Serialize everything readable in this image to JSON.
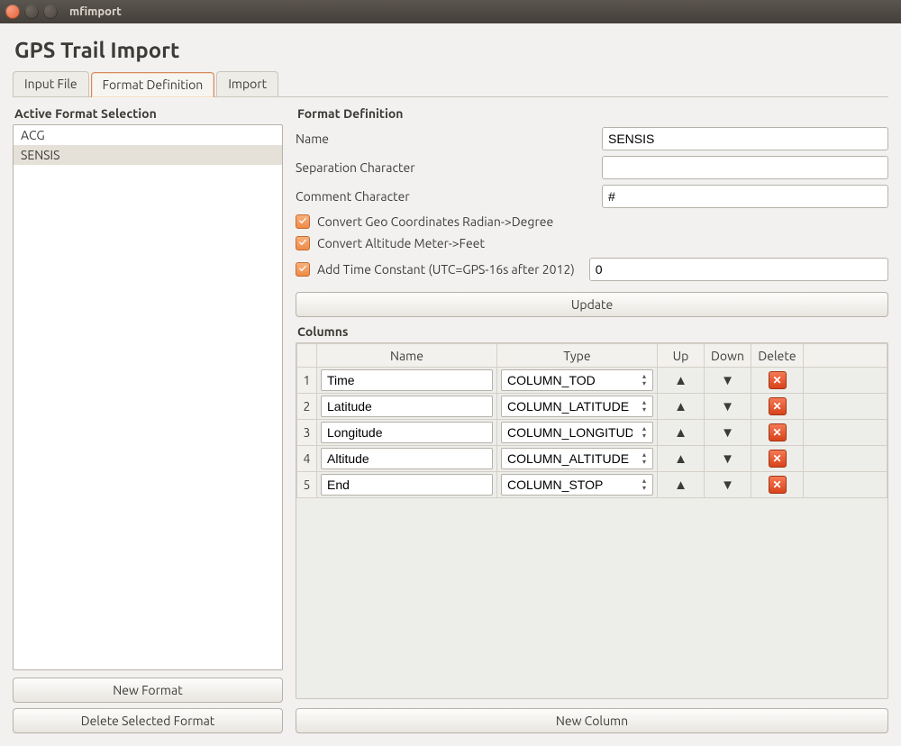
{
  "window": {
    "title": "mfimport"
  },
  "page_title": "GPS Trail Import",
  "tabs": [
    {
      "label": "Input File",
      "active": false
    },
    {
      "label": "Format Definition",
      "active": true
    },
    {
      "label": "Import",
      "active": false
    }
  ],
  "left": {
    "heading": "Active Format Selection",
    "items": [
      {
        "label": "ACG",
        "selected": false
      },
      {
        "label": "SENSIS",
        "selected": true
      }
    ],
    "new_format_label": "New Format",
    "delete_format_label": "Delete Selected Format"
  },
  "form": {
    "heading": "Format Definition",
    "name_label": "Name",
    "name_value": "SENSIS",
    "sep_label": "Separation Character",
    "sep_value": "",
    "comment_label": "Comment Character",
    "comment_value": "#",
    "chk_geo_label": "Convert Geo Coordinates Radian->Degree",
    "chk_geo_checked": true,
    "chk_alt_label": "Convert Altitude Meter->Feet",
    "chk_alt_checked": true,
    "chk_time_label": "Add Time Constant (UTC=GPS-16s after 2012)",
    "chk_time_checked": true,
    "time_value": "0",
    "update_label": "Update"
  },
  "columns": {
    "heading": "Columns",
    "headers": {
      "name": "Name",
      "type": "Type",
      "up": "Up",
      "down": "Down",
      "delete": "Delete"
    },
    "rows": [
      {
        "idx": "1",
        "name": "Time",
        "type": "COLUMN_TOD"
      },
      {
        "idx": "2",
        "name": "Latitude",
        "type": "COLUMN_LATITUDE"
      },
      {
        "idx": "3",
        "name": "Longitude",
        "type": "COLUMN_LONGITUDE"
      },
      {
        "idx": "4",
        "name": "Altitude",
        "type": "COLUMN_ALTITUDE"
      },
      {
        "idx": "5",
        "name": "End",
        "type": "COLUMN_STOP"
      }
    ],
    "new_column_label": "New Column"
  }
}
